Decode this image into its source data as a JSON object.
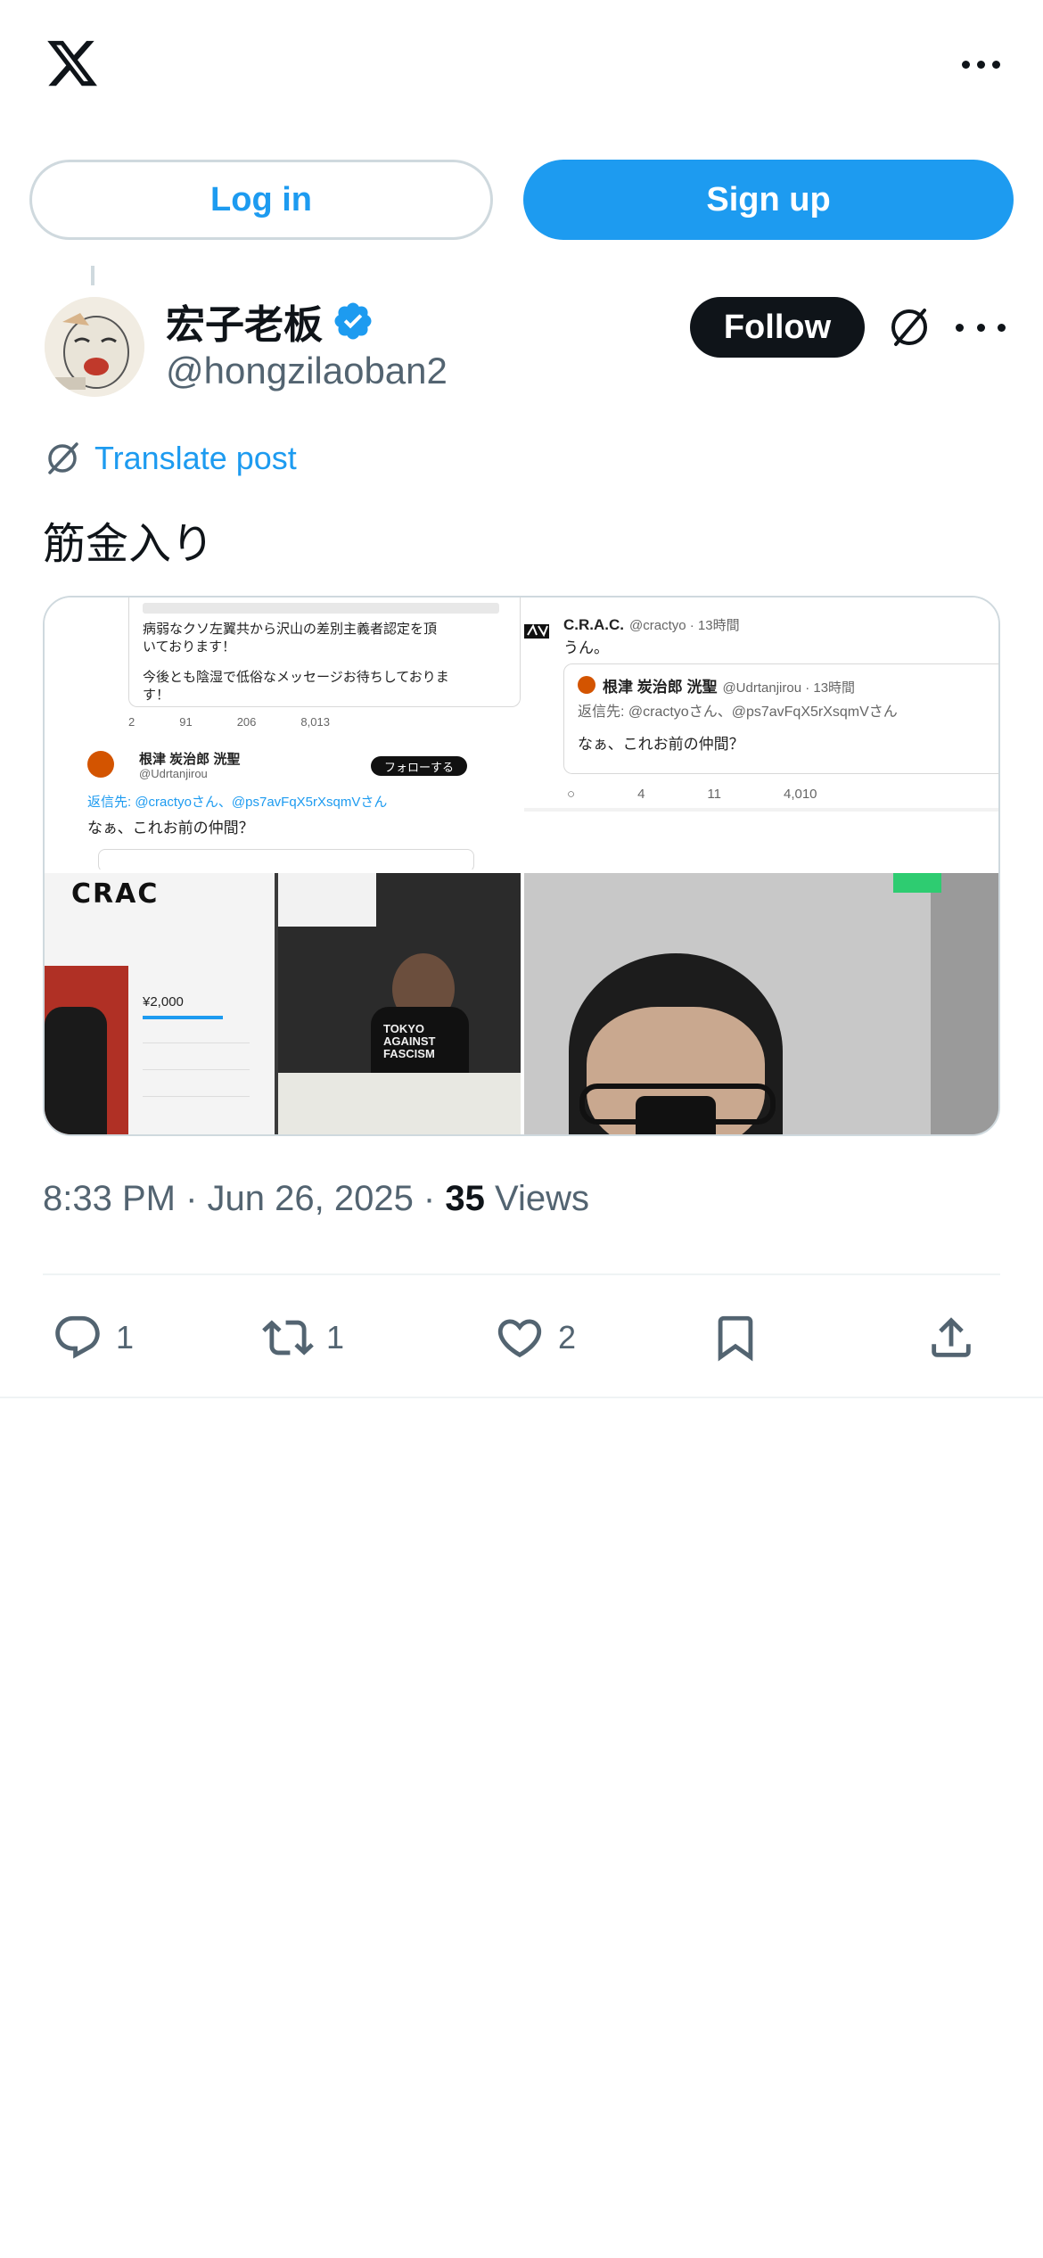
{
  "header": {
    "logo_icon": "x-logo-icon",
    "more_icon": "more-icon"
  },
  "auth": {
    "login_label": "Log in",
    "signup_label": "Sign up"
  },
  "author": {
    "name": "宏子老板",
    "handle": "@hongzilaoban2",
    "verified": true,
    "follow_label": "Follow"
  },
  "post": {
    "translate_label": "Translate post",
    "text": "筋金入り",
    "timestamp": "8:33 PM · Jun 26, 2025 · ",
    "views_count": "35",
    "views_label": " Views"
  },
  "media": {
    "left_screenshot": {
      "tweet_body_line1": "病弱なクソ左翼共から沢山の差別主義者認定を頂",
      "tweet_body_line2": "いております！",
      "tweet_body_line3": "今後とも陰湿で低俗なメッセージお待ちしておりま",
      "tweet_body_line4": "す！",
      "stats": [
        "2",
        "91",
        "206",
        "8,013"
      ],
      "reply_name": "根津 炭治郎 洸聖",
      "reply_handle": "@Udrtanjirou",
      "reply_follow": "フォローする",
      "reply_to": "返信先: @cractyoさん、@ps7avFqX5rXsqmVさん",
      "reply_text": "なぁ、これお前の仲間？"
    },
    "right_screenshot": {
      "name": "C.R.A.C.",
      "handle_time": "@cractyo · 13時間",
      "text": "うん。",
      "quote_name": "根津 炭治郎 洸聖",
      "quote_handle_time": "@Udrtanjirou · 13時間",
      "quote_reply_to": "返信先: @cractyoさん、@ps7avFqX5rXsqmVさん",
      "quote_text": "なぁ、これお前の仲間？",
      "stats": [
        "4",
        "11",
        "4,010"
      ]
    },
    "bottom_left_photo": {
      "shirt_text": "TOKYO AGAINST FASCISM",
      "logo_text": "CRAC",
      "price": "¥2,000"
    }
  },
  "actions": {
    "reply_count": "1",
    "repost_count": "1",
    "like_count": "2"
  },
  "colors": {
    "accent": "#1d9bf0",
    "text": "#0f1419",
    "muted": "#536471",
    "border": "#cfd9de"
  }
}
